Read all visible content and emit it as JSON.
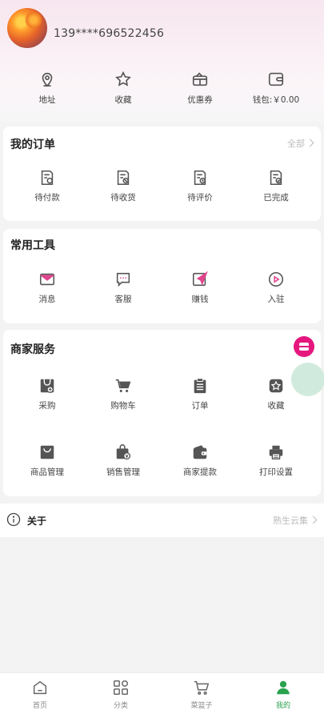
{
  "profile": {
    "phone": "139****696522456"
  },
  "quick_links": [
    {
      "label": "地址",
      "icon": "location-icon"
    },
    {
      "label": "收藏",
      "icon": "star-icon"
    },
    {
      "label": "优惠券",
      "icon": "coupon-icon"
    },
    {
      "label": "钱包:￥0.00",
      "icon": "wallet-icon"
    }
  ],
  "orders": {
    "title": "我的订单",
    "more": "全部",
    "items": [
      {
        "label": "待付款",
        "icon": "pending-payment-icon"
      },
      {
        "label": "待收货",
        "icon": "pending-receipt-icon"
      },
      {
        "label": "待评价",
        "icon": "pending-review-icon"
      },
      {
        "label": "已完成",
        "icon": "completed-icon"
      }
    ]
  },
  "tools": {
    "title": "常用工具",
    "items": [
      {
        "label": "消息",
        "icon": "message-icon"
      },
      {
        "label": "客服",
        "icon": "customer-service-icon"
      },
      {
        "label": "赚钱",
        "icon": "send-icon"
      },
      {
        "label": "入驻",
        "icon": "play-icon"
      }
    ]
  },
  "merchant": {
    "title": "商家服务",
    "items": [
      {
        "label": "采购",
        "icon": "purchase-icon"
      },
      {
        "label": "购物车",
        "icon": "cart-icon"
      },
      {
        "label": "订单",
        "icon": "clipboard-icon"
      },
      {
        "label": "收藏",
        "icon": "favorite-icon"
      },
      {
        "label": "商品管理",
        "icon": "bag-icon"
      },
      {
        "label": "销售管理",
        "icon": "sales-icon"
      },
      {
        "label": "商家提款",
        "icon": "withdraw-wallet-icon"
      },
      {
        "label": "打印设置",
        "icon": "printer-icon"
      }
    ]
  },
  "about": {
    "label": "关于",
    "value": "熟生云集"
  },
  "tabbar": [
    {
      "label": "首页",
      "icon": "home-icon",
      "active": false
    },
    {
      "label": "分类",
      "icon": "category-icon",
      "active": false
    },
    {
      "label": "菜篮子",
      "icon": "basket-icon",
      "active": false
    },
    {
      "label": "我的",
      "icon": "user-icon",
      "active": true
    }
  ],
  "colors": {
    "accent_pink": "#e5177e",
    "active_green": "#2aa24e",
    "header_pink": "#f7e6ef"
  }
}
